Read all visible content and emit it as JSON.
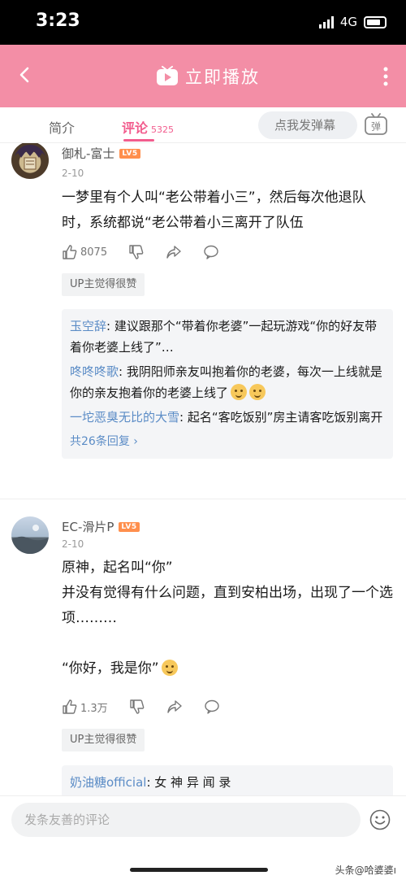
{
  "status_bar": {
    "time": "3:23",
    "network": "4G"
  },
  "nav": {
    "title": "立即播放"
  },
  "tabs": {
    "intro": "简介",
    "comments": "评论",
    "comment_count": "5325",
    "danmaku_placeholder": "点我发弹幕",
    "danmaku_icon_label": "弹"
  },
  "comments": [
    {
      "username": "御札-富士",
      "level": "LV5",
      "date": "2-10",
      "text": "一梦里有个人叫“老公带着小三”，然后每次他退队时，系统都说“老公带着小三离开了队伍",
      "likes": "8075",
      "up_liked": "UP主觉得很赞",
      "replies": [
        {
          "name": "玉空辞",
          "text": ": 建议跟那个“带着你老婆”一起玩游戏“你的好友带着你老婆上线了”…"
        },
        {
          "name": "咚咚咚歌",
          "text": ": 我阴阳师亲友叫抱着你的老婆，每次一上线就是你的亲友抱着你的老婆上线了"
        },
        {
          "name": "一坨恶臭无比的大雪",
          "text": ": 起名“客吃饭别”房主请客吃饭别离开"
        }
      ],
      "more_replies": "共26条回复 ›"
    },
    {
      "username": "EC-滑片P",
      "level": "LV5",
      "date": "2-10",
      "text_lines": [
        "原神，起名叫“你”",
        "并没有觉得有什么问题，直到安柏出场，出现了一个选项………",
        "",
        "“你好，我是你”"
      ],
      "likes": "1.3万",
      "up_liked": "UP主觉得很赞",
      "replies": [
        {
          "name": "奶油糖official",
          "text": ": 女 神 异 闻 录"
        }
      ]
    }
  ],
  "bottom": {
    "input_placeholder": "发条友善的评论",
    "watermark": "头条@哈婆婆ı"
  },
  "colors": {
    "nav_pink": "#f38ea6",
    "accent": "#f25d8e",
    "reply_name": "#5b8cc6"
  }
}
